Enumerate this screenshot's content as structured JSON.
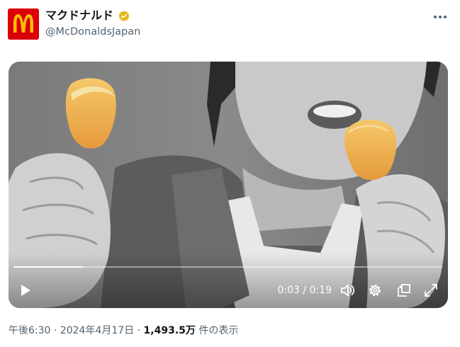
{
  "author": {
    "display_name": "マクドナルド",
    "handle": "@McDonaldsJapan",
    "avatar_icon": "mcdonalds-arches-logo",
    "verified_icon": "verified-gold-badge-icon",
    "brand_color": "#db0007",
    "arches_color": "#ffbc0d",
    "verified_color": "#e2b719"
  },
  "menu": {
    "more_icon": "more-horizontal-icon"
  },
  "video": {
    "current_time": "0:03",
    "separator": "/",
    "duration": "0:19",
    "progress": 0.16,
    "icons": {
      "play": "play-icon",
      "volume": "volume-icon",
      "settings": "gear-icon",
      "pip": "picture-in-picture-icon",
      "fullscreen": "fullscreen-icon"
    }
  },
  "meta": {
    "time": "午後6:30",
    "dot1": "·",
    "date": "2024年4月17日",
    "dot2": "·",
    "views": "1,493.5万",
    "views_label": "件の表示"
  }
}
